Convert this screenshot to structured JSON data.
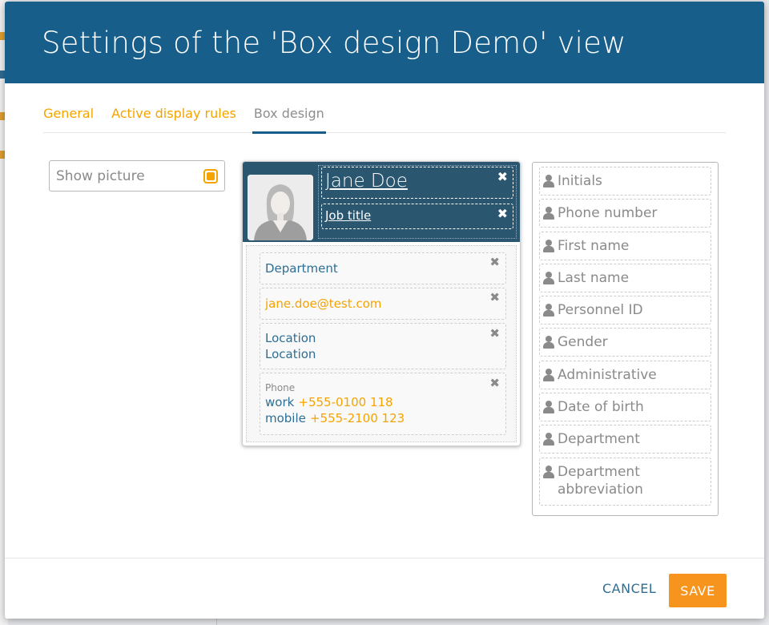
{
  "dialog": {
    "title": "Settings of the 'Box design Demo' view"
  },
  "tabs": [
    {
      "label": "General"
    },
    {
      "label": "Active display rules"
    },
    {
      "label": "Box design"
    }
  ],
  "show_picture": {
    "label": "Show picture",
    "checked": true
  },
  "card": {
    "name": "Jane Doe",
    "job_title": "Job title",
    "department": "Department",
    "email": "jane.doe@test.com",
    "location_line1": "Location",
    "location_line2": "Location",
    "phone_label": "Phone",
    "work_label": "work",
    "work_number": "+555-0100 118",
    "mobile_label": "mobile",
    "mobile_number": "+555-2100 123",
    "remove_glyph": "✖"
  },
  "available_fields": [
    {
      "label": "Initials"
    },
    {
      "label": "Phone number"
    },
    {
      "label": "First name"
    },
    {
      "label": "Last name"
    },
    {
      "label": "Personnel ID"
    },
    {
      "label": "Gender"
    },
    {
      "label": "Administrative"
    },
    {
      "label": "Date of birth"
    },
    {
      "label": "Department"
    },
    {
      "label": "Department abbreviation"
    }
  ],
  "footer": {
    "cancel_label": "CANCEL",
    "save_label": "SAVE"
  },
  "colors": {
    "header": "#175e8a",
    "accent": "#f5a300",
    "card_head": "#2a5670",
    "link_blue": "#2e6e94"
  }
}
